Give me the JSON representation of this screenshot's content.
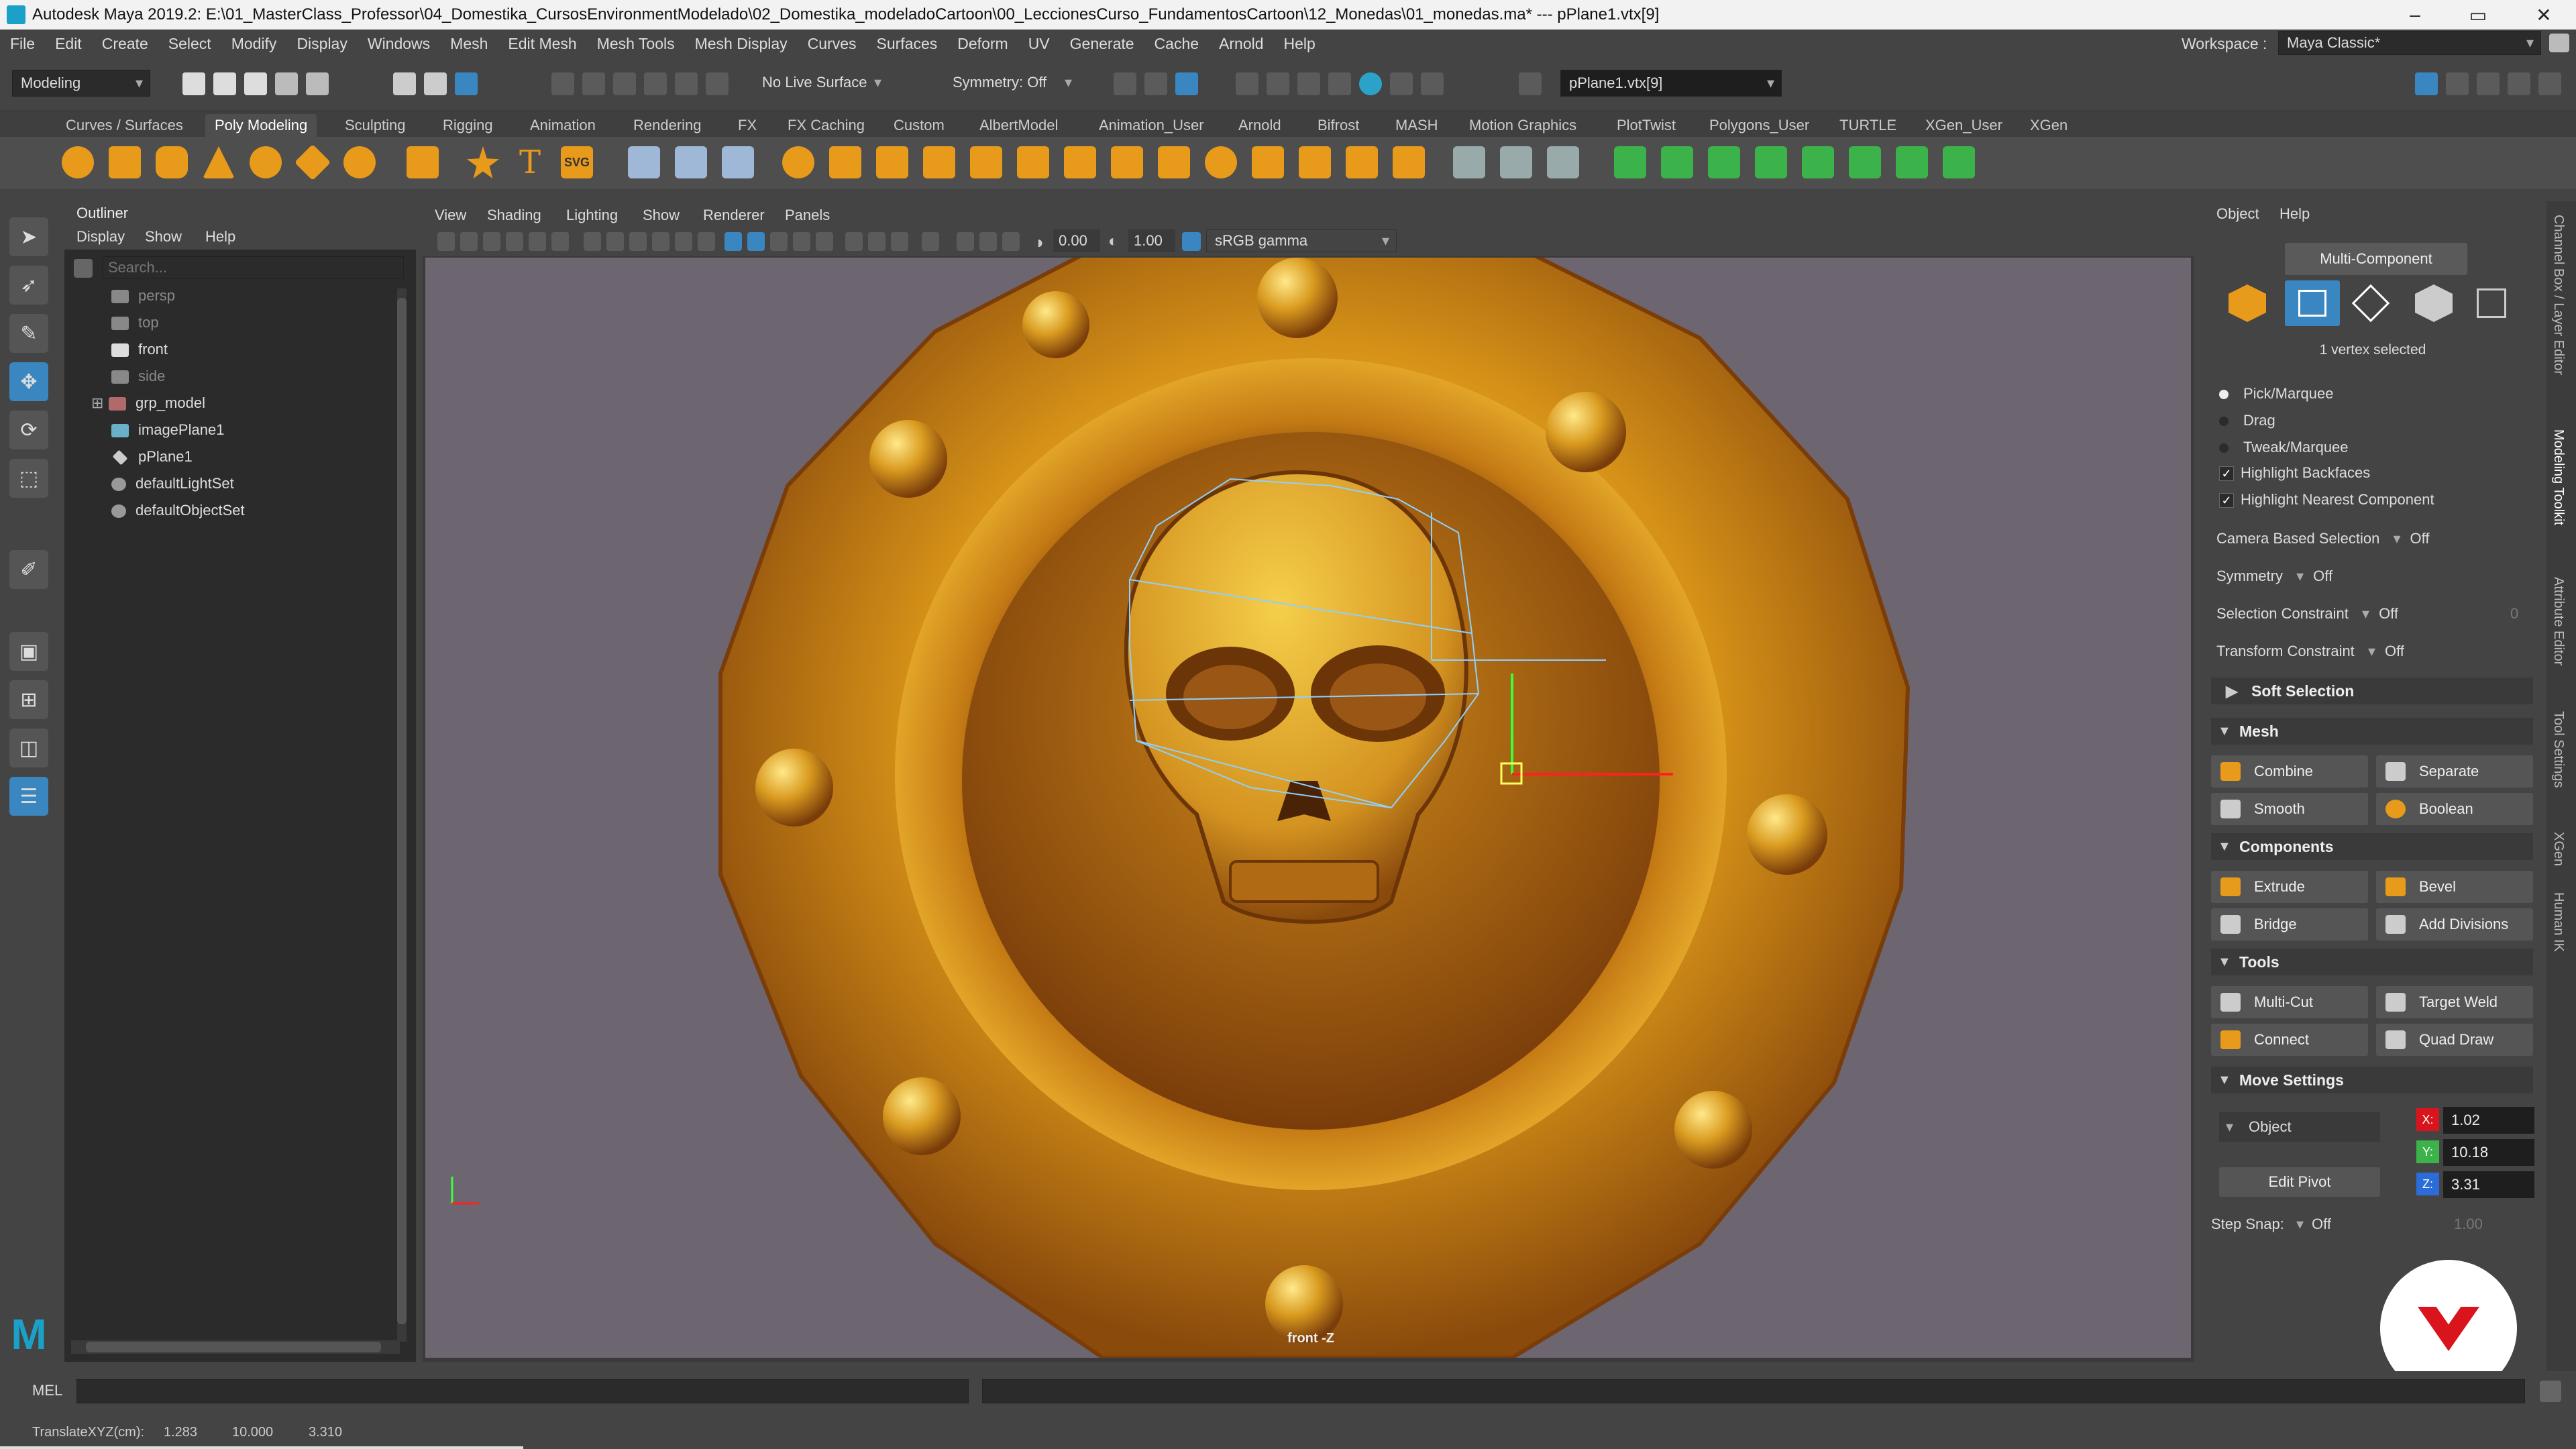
{
  "titlebar": {
    "title": "Autodesk Maya 2019.2: E:\\01_MasterClass_Professor\\04_Domestika_CursosEnvironmentModelado\\02_Domestika_modeladoCartoon\\00_LeccionesCurso_FundamentosCartoon\\12_Monedas\\01_monedas.ma*  ---  pPlane1.vtx[9]",
    "minimize": "–",
    "maximize": "▭",
    "close": "✕"
  },
  "menubar": {
    "items": [
      "File",
      "Edit",
      "Create",
      "Select",
      "Modify",
      "Display",
      "Windows",
      "Mesh",
      "Edit Mesh",
      "Mesh Tools",
      "Mesh Display",
      "Curves",
      "Surfaces",
      "Deform",
      "UV",
      "Generate",
      "Cache",
      "Arnold",
      "Help"
    ],
    "workspace_label": "Workspace :",
    "workspace_value": "Maya Classic*"
  },
  "statusline": {
    "menuset": "Modeling",
    "live_surface": "No Live Surface",
    "symmetry": "Symmetry: Off",
    "selection_field": "pPlane1.vtx[9]"
  },
  "shelf": {
    "tabs": [
      "Curves / Surfaces",
      "Poly Modeling",
      "Sculpting",
      "Rigging",
      "Animation",
      "Rendering",
      "FX",
      "FX Caching",
      "Custom",
      "AlbertModel",
      "Animation_User",
      "Arnold",
      "Bifrost",
      "MASH",
      "Motion Graphics",
      "PlotTwist",
      "Polygons_User",
      "TURTLE",
      "XGen_User",
      "XGen"
    ],
    "active_tab": "Poly Modeling",
    "text_icons": [
      "T",
      "SVG"
    ]
  },
  "outliner": {
    "title": "Outliner",
    "menu": [
      "Display",
      "Show",
      "Help"
    ],
    "search_placeholder": "Search...",
    "items": [
      {
        "label": "persp",
        "dim": true
      },
      {
        "label": "top",
        "dim": true
      },
      {
        "label": "front",
        "dim": false
      },
      {
        "label": "side",
        "dim": true
      },
      {
        "label": "grp_model",
        "dim": false
      },
      {
        "label": "imagePlane1",
        "dim": false
      },
      {
        "label": "pPlane1",
        "dim": false
      },
      {
        "label": "defaultLightSet",
        "dim": false
      },
      {
        "label": "defaultObjectSet",
        "dim": false
      }
    ]
  },
  "viewport": {
    "menu": [
      "View",
      "Shading",
      "Lighting",
      "Show",
      "Renderer",
      "Panels"
    ],
    "exposure": "0.00",
    "gamma": "1.00",
    "colorspace": "sRGB gamma",
    "camera_label": "front -Z"
  },
  "toolkit": {
    "menu": [
      "Object",
      "Help"
    ],
    "mode_button": "Multi-Component",
    "selection_status": "1 vertex selected",
    "pick_modes": [
      "Pick/Marquee",
      "Drag",
      "Tweak/Marquee"
    ],
    "checks": [
      {
        "label": "Highlight Backfaces",
        "checked": true
      },
      {
        "label": "Highlight Nearest Component",
        "checked": true
      }
    ],
    "options": [
      {
        "label": "Camera Based Selection",
        "value": "Off"
      },
      {
        "label": "Symmetry",
        "value": "Off"
      },
      {
        "label": "Selection Constraint",
        "value": "Off",
        "extra": "0"
      },
      {
        "label": "Transform Constraint",
        "value": "Off"
      }
    ],
    "soft_selection": "Soft Selection",
    "sections": {
      "mesh": {
        "title": "Mesh",
        "buttons": [
          "Combine",
          "Separate",
          "Smooth",
          "Boolean"
        ]
      },
      "components": {
        "title": "Components",
        "buttons": [
          "Extrude",
          "Bevel",
          "Bridge",
          "Add Divisions"
        ]
      },
      "tools": {
        "title": "Tools",
        "buttons": [
          "Multi-Cut",
          "Target Weld",
          "Connect",
          "Quad Draw"
        ]
      }
    },
    "move_settings": {
      "title": "Move Settings",
      "space": "Object",
      "edit_pivot": "Edit Pivot",
      "x_label": "X:",
      "x": "1.02",
      "y_label": "Y:",
      "y": "10.18",
      "z_label": "Z:",
      "z": "3.31",
      "step_snap_label": "Step Snap:",
      "step_snap_value": "Off",
      "step_snap_amount": "1.00"
    }
  },
  "sidetabs": [
    "Channel Box / Layer Editor",
    "Modeling Toolkit",
    "Attribute Editor",
    "Tool Settings",
    "XGen",
    "Human IK"
  ],
  "commandline": {
    "label": "MEL"
  },
  "helpline": {
    "label": "TranslateXYZ(cm):",
    "x": "1.283",
    "y": "10.000",
    "z": "3.310"
  },
  "colors": {
    "maya_blue": "#1ba0c8",
    "shelf_orange": "#e89a1a",
    "shelf_green": "#3cb34a",
    "coin_gold": "#d69a16",
    "brand_red": "#d9141c"
  }
}
